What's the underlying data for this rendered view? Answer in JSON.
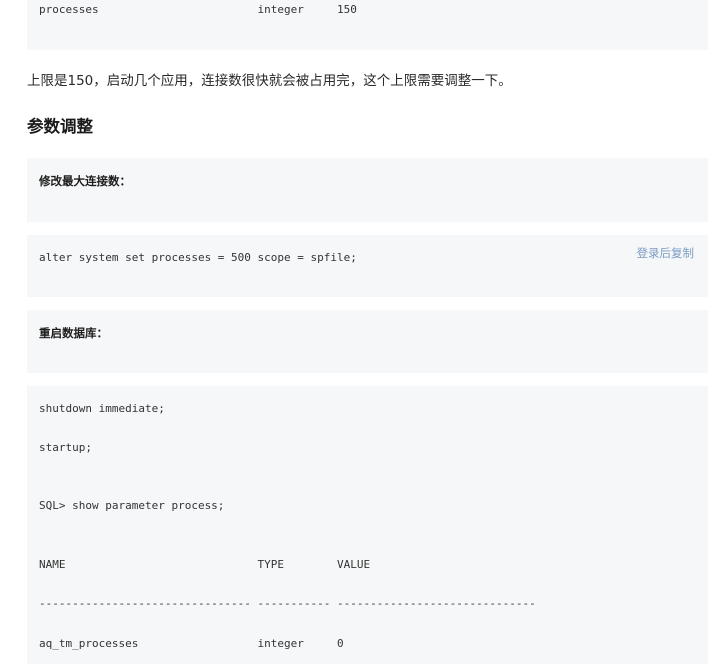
{
  "top_block": {
    "line": "processes                        integer     150"
  },
  "paragraph": "上限是150，启动几个应用，连接数很快就会被占用完，这个上限需要调整一下。",
  "section_heading": "参数调整",
  "step1_label": "修改最大连接数：",
  "alter_block": {
    "command": "alter system set processes = 500 scope = spfile;",
    "copy_label": "登录后复制"
  },
  "step2_label": "重启数据库：",
  "restart_block": {
    "lines": [
      "shutdown immediate;",
      "startup;",
      "SQL> show parameter process;",
      "NAME                             TYPE        VALUE",
      "-------------------------------- ----------- ------------------------------",
      "aq_tm_processes                  integer     0"
    ]
  }
}
